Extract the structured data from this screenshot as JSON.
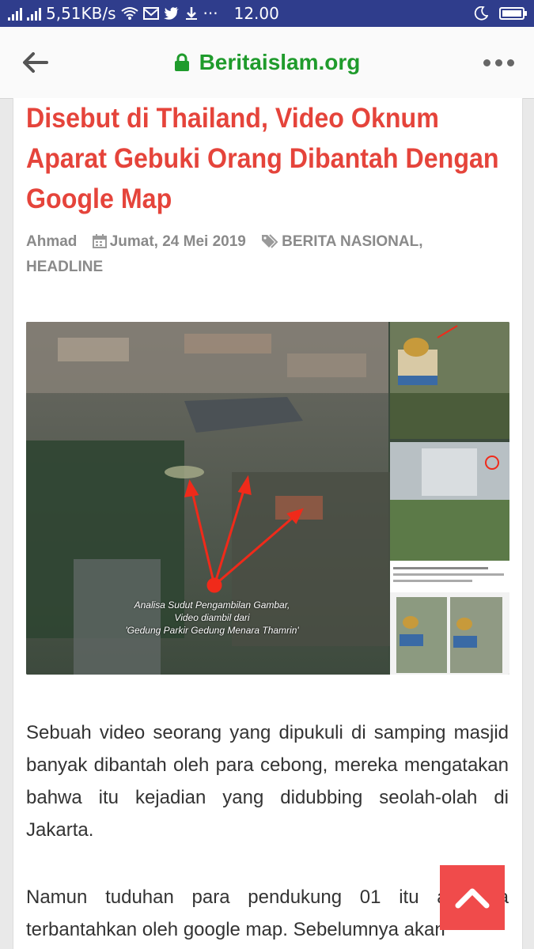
{
  "status_bar": {
    "network_speed": "5,51KB/s",
    "time": "12.00",
    "battery_level": 0.85,
    "icons": [
      "signal-icon",
      "signal-icon",
      "wifi-icon",
      "mail-icon",
      "twitter-icon",
      "download-icon",
      "more-icon",
      "moon-icon",
      "battery-icon"
    ],
    "ellipsis": "···"
  },
  "browser": {
    "url": "Beritaislam.org",
    "secure_color": "#1f9b2c"
  },
  "article": {
    "title": "Disebut di Thailand, Video Oknum Aparat Gebuki Orang Dibantah Dengan Google Map",
    "author": "Ahmad",
    "date": "Jumat, 24 Mei 2019",
    "categories": "BERITA NASIONAL, HEADLINE",
    "image_caption_lines": [
      "Analisa Sudut Pengambilan Gambar,",
      "Video diambil dari",
      "'Gedung Parkir Gedung Menara Thamrin'"
    ],
    "paragraphs": [
      "Sebuah video seorang yang dipukuli di samping masjid banyak dibantah oleh para cebong, mereka mengatakan bahwa itu kejadian yang didubbing seolah-olah di Jakarta.",
      "Namun tuduhan para pendukung 01 itu akhirnya terbantahkan oleh google map. Sebelumnya akan"
    ],
    "title_color": "#e5443b"
  }
}
